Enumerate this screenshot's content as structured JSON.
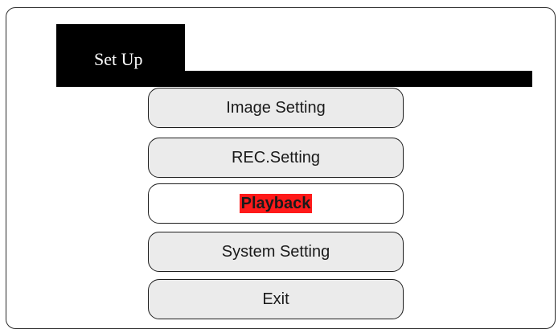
{
  "title": "Set Up",
  "menu": {
    "items": [
      {
        "label": "Image Setting",
        "selected": false
      },
      {
        "label": "REC.Setting",
        "selected": false
      },
      {
        "label": "Playback",
        "selected": true
      },
      {
        "label": "System Setting",
        "selected": false
      },
      {
        "label": "Exit",
        "selected": false
      }
    ]
  },
  "colors": {
    "highlight": "#ff1a1a",
    "button_bg": "#ebebeb",
    "title_bg": "#000000"
  }
}
